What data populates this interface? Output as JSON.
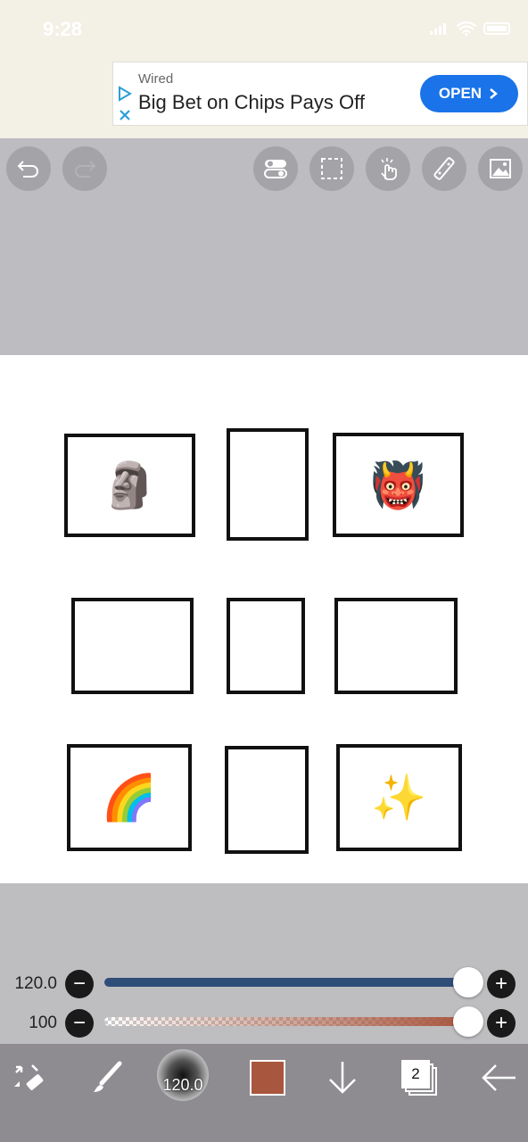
{
  "status": {
    "time": "9:28"
  },
  "ad": {
    "source": "Wired",
    "headline": "Big Bet on Chips Pays Off",
    "cta": "OPEN"
  },
  "toolbar": {
    "left_icons": [
      "undo-icon",
      "redo-icon"
    ],
    "right_icons": [
      "toggle-icon",
      "selection-icon",
      "hand-touch-icon",
      "ruler-icon",
      "image-icon"
    ]
  },
  "canvas": {
    "panels": [
      {
        "emoji": "🗿"
      },
      {
        "emoji": ""
      },
      {
        "emoji": "👹"
      },
      {
        "emoji": ""
      },
      {
        "emoji": ""
      },
      {
        "emoji": ""
      },
      {
        "emoji": "🌈"
      },
      {
        "emoji": ""
      },
      {
        "emoji": "✨"
      }
    ]
  },
  "brush": {
    "size_label": "120.0",
    "opacity_label": "100",
    "size_level": 1.0,
    "opacity_level": 1.0,
    "color": "#a8563e",
    "size_track_color": "#2e4e78"
  },
  "bottombar": {
    "brush_size": "120.0",
    "layer_count": "2",
    "color_swatch": "#a8563e"
  }
}
